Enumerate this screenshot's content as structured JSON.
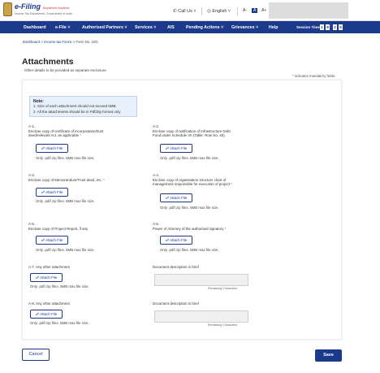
{
  "header": {
    "logo_title": "e-Filing",
    "logo_tagline": "Anywhere Anytime",
    "logo_sub": "Income Tax Department, Government of India",
    "call_us": "Call Us",
    "language": "English",
    "font_small": "A-",
    "font_normal": "A",
    "font_large": "A+"
  },
  "nav": {
    "items": [
      "Dashboard",
      "e-File",
      "Authorised Partners",
      "Services",
      "AIS",
      "Pending Actions",
      "Grievances",
      "Help"
    ],
    "session_label": "Session Time",
    "session_digits": [
      "1",
      "8",
      "2",
      "5"
    ]
  },
  "breadcrumb": {
    "items": [
      "Dashboard",
      "Income-tax Forms",
      "Form No. 10G"
    ],
    "separator": ">"
  },
  "page": {
    "title": "Attachments",
    "subtitle": "Other details to be provided as separate enclosure",
    "mandatory_note": "indicates mandatory fields",
    "mandatory_star": "*"
  },
  "note": {
    "title": "Note:",
    "lines": [
      "1. Size of each attachment should not exceed 5MB.",
      "2. All the attachments should be in Pdf/Zip format only"
    ]
  },
  "attachments": {
    "button_label": "Attach File",
    "hint": "Only .pdf/.zip files. 5MB max file size.",
    "a1": {
      "id": "A-1.",
      "line1": "Enclose copy of certificate of incorporation/trust",
      "line2": "deed/relevant Act, as applicable"
    },
    "a2": {
      "id": "A-2.",
      "line1": "Enclose copy of notification of Infrastructure Debt",
      "line2": "Fund under Schedule VII (Table: Row No. 4b)"
    },
    "a3": {
      "id": "A-3.",
      "line1": "Enclose copy of Memorandum/Trust deed, etc."
    },
    "a4": {
      "id": "A-4.",
      "line1": "Enclose copy of organisation structure chart of",
      "line2": "management responsible for execution of project"
    },
    "a5": {
      "id": "A-5.",
      "line1": "Enclose copy of Project Report, if any"
    },
    "a6": {
      "id": "A-6.",
      "line1": "Power of Attorney of the authorised signatory"
    },
    "a7": {
      "label": "A-7. Any other attachment",
      "desc_label": "Document description in brief",
      "remaining": "Remaining Characters:"
    },
    "a8": {
      "label": "A-8. Any other attachment",
      "desc_label": "Document description in brief",
      "remaining": "Remaining Characters:"
    }
  },
  "footer": {
    "cancel": "Cancel",
    "save": "Save"
  },
  "colors": {
    "brand": "#1b3a8c",
    "required": "#dd3333",
    "note_bg": "#e8f1fb"
  }
}
